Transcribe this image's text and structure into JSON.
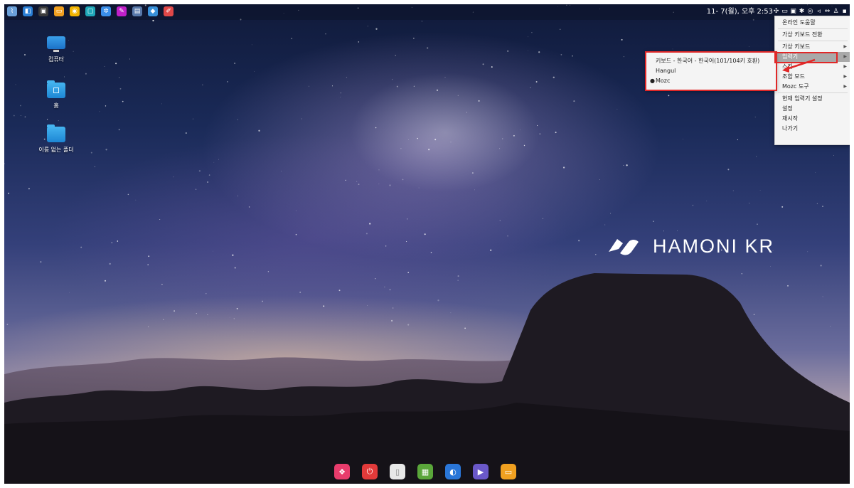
{
  "top_panel": {
    "launchers": [
      {
        "name": "hamonikr-menu-icon",
        "color": "#6aa0d8",
        "glyph": "⌇"
      },
      {
        "name": "app-blue-icon",
        "color": "#2a7fd4",
        "glyph": "◧"
      },
      {
        "name": "terminal-icon",
        "color": "#3a3a3a",
        "glyph": "▣"
      },
      {
        "name": "files-icon",
        "color": "#f0a020",
        "glyph": "▭"
      },
      {
        "name": "chrome-icon",
        "color": "#f1b400",
        "glyph": "◉"
      },
      {
        "name": "teal-app-icon",
        "color": "#20a8b8",
        "glyph": "▢"
      },
      {
        "name": "settings-icon",
        "color": "#3a8ee8",
        "glyph": "✲"
      },
      {
        "name": "draw-icon",
        "color": "#c020c8",
        "glyph": "✎"
      },
      {
        "name": "display-icon",
        "color": "#5878a8",
        "glyph": "▤"
      },
      {
        "name": "software-icon",
        "color": "#3890d8",
        "glyph": "◆"
      },
      {
        "name": "text-editor-icon",
        "color": "#e04848",
        "glyph": "✐"
      }
    ],
    "clock": "11- 7(월), 오후 2:53",
    "tray_icons": [
      "input-method-icon",
      "battery-icon",
      "clipboard-icon",
      "bluetooth-icon",
      "network-icon",
      "volume-icon",
      "swap-icon",
      "user-icon",
      "notification-icon"
    ]
  },
  "desktop": {
    "items": [
      {
        "label": "컴퓨터",
        "icon": "computer-icon"
      },
      {
        "label": "홈",
        "icon": "home-folder-icon"
      },
      {
        "label": "이름 없는 폴더",
        "icon": "folder-icon"
      }
    ]
  },
  "logo": {
    "text": "HAMONI KR"
  },
  "menu": {
    "items": [
      {
        "label": "온라인 도움말",
        "submenu": false
      },
      {
        "label": "가상 키보드 전환",
        "submenu": false
      },
      {
        "label": "가상 키보드",
        "submenu": true
      },
      {
        "label": "입력기",
        "submenu": true,
        "active": true
      },
      {
        "label": "스킨",
        "submenu": true
      },
      {
        "label": "조합 모드",
        "submenu": true
      },
      {
        "label": "Mozc 도구",
        "submenu": true
      },
      {
        "label": "현재 입력기 설정",
        "submenu": false
      },
      {
        "label": "설정",
        "submenu": false
      },
      {
        "label": "재시작",
        "submenu": false
      },
      {
        "label": "나가기",
        "submenu": false
      }
    ]
  },
  "submenu": {
    "items": [
      {
        "label": "키보드 - 한국어 - 한국어(101/104키 호환)",
        "selected": false
      },
      {
        "label": "Hangul",
        "selected": false
      },
      {
        "label": "Mozc",
        "selected": true
      }
    ],
    "bullet": "●"
  },
  "dock": {
    "apps": [
      {
        "name": "app-launcher-icon",
        "color": "#e83c6c",
        "glyph": "❖"
      },
      {
        "name": "power-icon",
        "color": "#e23a3a",
        "glyph": "⏻"
      },
      {
        "name": "trash-icon",
        "color": "#e8e8e8",
        "glyph": "▯"
      },
      {
        "name": "store-icon",
        "color": "#5aa63a",
        "glyph": "▦"
      },
      {
        "name": "browser-icon",
        "color": "#2a76d8",
        "glyph": "◐"
      },
      {
        "name": "media-player-icon",
        "color": "#6a58c8",
        "glyph": "▶"
      },
      {
        "name": "files-icon",
        "color": "#f0a020",
        "glyph": "▭"
      }
    ]
  },
  "colors": {
    "highlight": "#e02828",
    "menu_active": "#a9a9a9"
  }
}
